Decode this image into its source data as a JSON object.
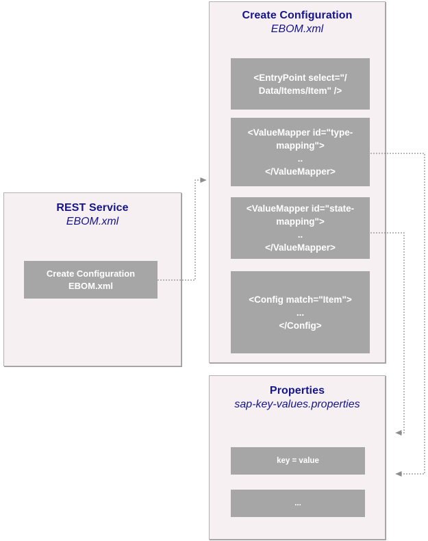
{
  "diagram": {
    "panels": {
      "rest_service": {
        "title": "REST Service",
        "subtitle": "EBOM.xml",
        "call_box": {
          "line1": "Create Configuration",
          "line2": "EBOM.xml"
        }
      },
      "create_configuration": {
        "title": "Create Configuration",
        "subtitle": "EBOM.xml",
        "blocks": {
          "entrypoint": {
            "line1": "<EntryPoint select=\"/",
            "line2": "Data/Items/Item\" />"
          },
          "type_mapping": {
            "line1": "<ValueMapper id=\"type-",
            "line2": "mapping\">",
            "line3": "..",
            "line4": "</ValueMapper>"
          },
          "state_mapping": {
            "line1": "<ValueMapper id=\"state-",
            "line2": "mapping\">",
            "line3": "..",
            "line4": "</ValueMapper>"
          },
          "config": {
            "line1": "<Config match=\"Item\">",
            "line2": "...",
            "line3": "</Config>"
          }
        }
      },
      "properties": {
        "title": "Properties",
        "subtitle": "sap-key-values.properties",
        "blocks": {
          "key_value": "key = value",
          "ellipsis": "..."
        }
      }
    },
    "connectors": [
      {
        "name": "rest-service-to-create-configuration",
        "from": "rest_service.call_box",
        "to": "create_configuration",
        "style": "dotted-arrow"
      },
      {
        "name": "type-mapping-to-properties",
        "from": "create_configuration.type_mapping",
        "to": "properties",
        "style": "dotted-arrow"
      },
      {
        "name": "state-mapping-to-properties",
        "from": "create_configuration.state_mapping",
        "to": "properties",
        "style": "dotted-arrow"
      }
    ],
    "colors": {
      "panel_background": "#f7f0f2",
      "panel_border": "#b3aeb0",
      "block_fill": "#a6a6a6",
      "block_text": "#ffffff",
      "title_text": "#14148c",
      "connector": "#8c8c8c"
    }
  }
}
